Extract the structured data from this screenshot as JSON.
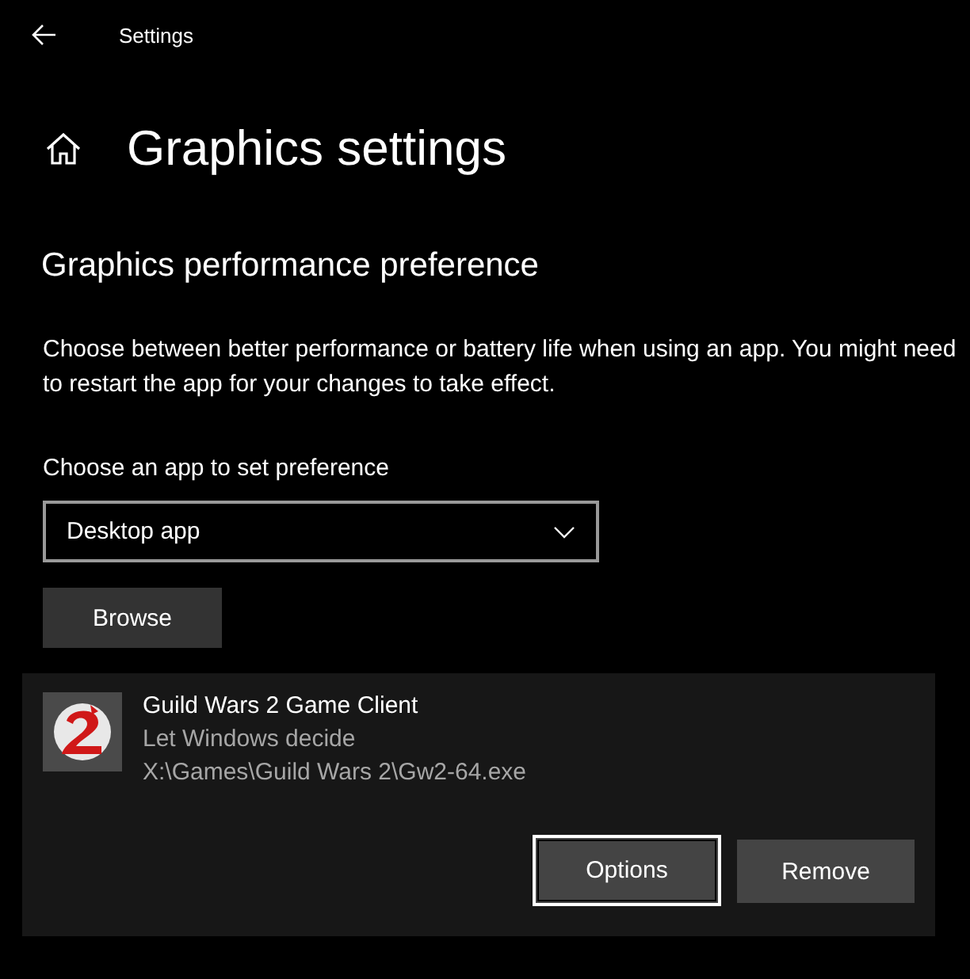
{
  "window": {
    "title": "Settings"
  },
  "page_title": "Graphics settings",
  "section_title": "Graphics performance preference",
  "description": "Choose between better performance or battery life when using an app. You might need to restart the app for your changes to take effect.",
  "app_type": {
    "label": "Choose an app to set preference",
    "value": "Desktop app"
  },
  "browse_button": "Browse",
  "apps": [
    {
      "name": "Guild Wars 2 Game Client",
      "preference": "Let Windows decide",
      "path": "X:\\Games\\Guild Wars 2\\Gw2-64.exe",
      "buttons": [
        {
          "label": "Options",
          "focused": true
        },
        {
          "label": "Remove",
          "focused": false
        }
      ]
    }
  ]
}
